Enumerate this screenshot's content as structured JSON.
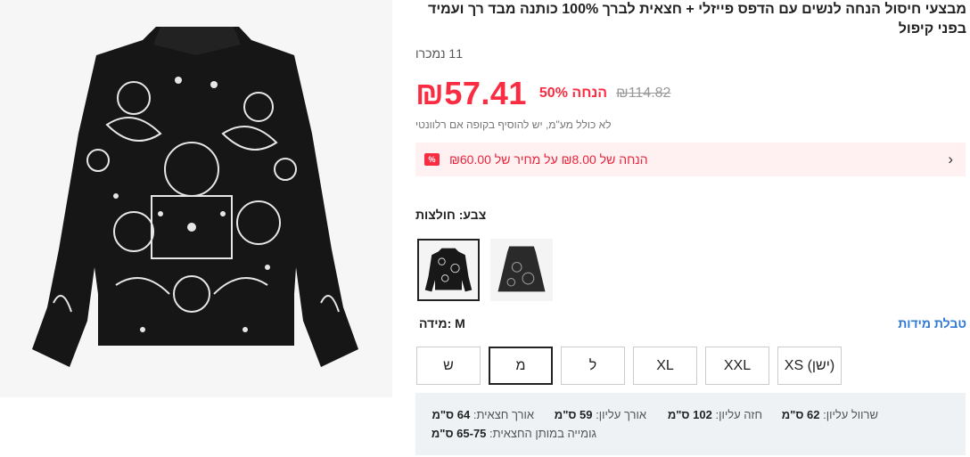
{
  "product": {
    "title": "מבצעי חיסול הנחה לנשים עם הדפס פייזלי + חצאית לברך 100% כותנה מבד רך ועמיד בפני קיפול",
    "sold_count": "11 נמכרו"
  },
  "price": {
    "current": "₪57.41",
    "discount": "50% הנחה",
    "original": "₪114.82"
  },
  "tax_note": "לא כולל מע\"מ, יש להוסיף בקופה אם רלוונטי",
  "promo": {
    "text": "הנחה של ₪8.00 על מחיר של ₪60.00",
    "badge": "%"
  },
  "color": {
    "label": "צבע: חולצות"
  },
  "size": {
    "guide_link": "טבלת מידות",
    "label": "מידה: M",
    "options": [
      "(ישן) XS",
      "XXL",
      "XL",
      "ל",
      "מ",
      "ש"
    ],
    "selected": "מ"
  },
  "measurements": {
    "row1": [
      {
        "label": "שרוול עליון:",
        "value": "62 ס\"מ"
      },
      {
        "label": "חזה עליון:",
        "value": "102 ס\"מ"
      },
      {
        "label": "אורך עליון:",
        "value": "59 ס\"מ"
      },
      {
        "label": "אורך חצאית:",
        "value": "64 ס\"מ"
      }
    ],
    "row2": [
      {
        "label": "גומייה במותן החצאית:",
        "value": "65-75 ס\"מ"
      }
    ]
  },
  "colors": {
    "accent_red": "#fa2c42",
    "link_blue": "#2f78d6",
    "promo_bg": "#fff0f1"
  }
}
